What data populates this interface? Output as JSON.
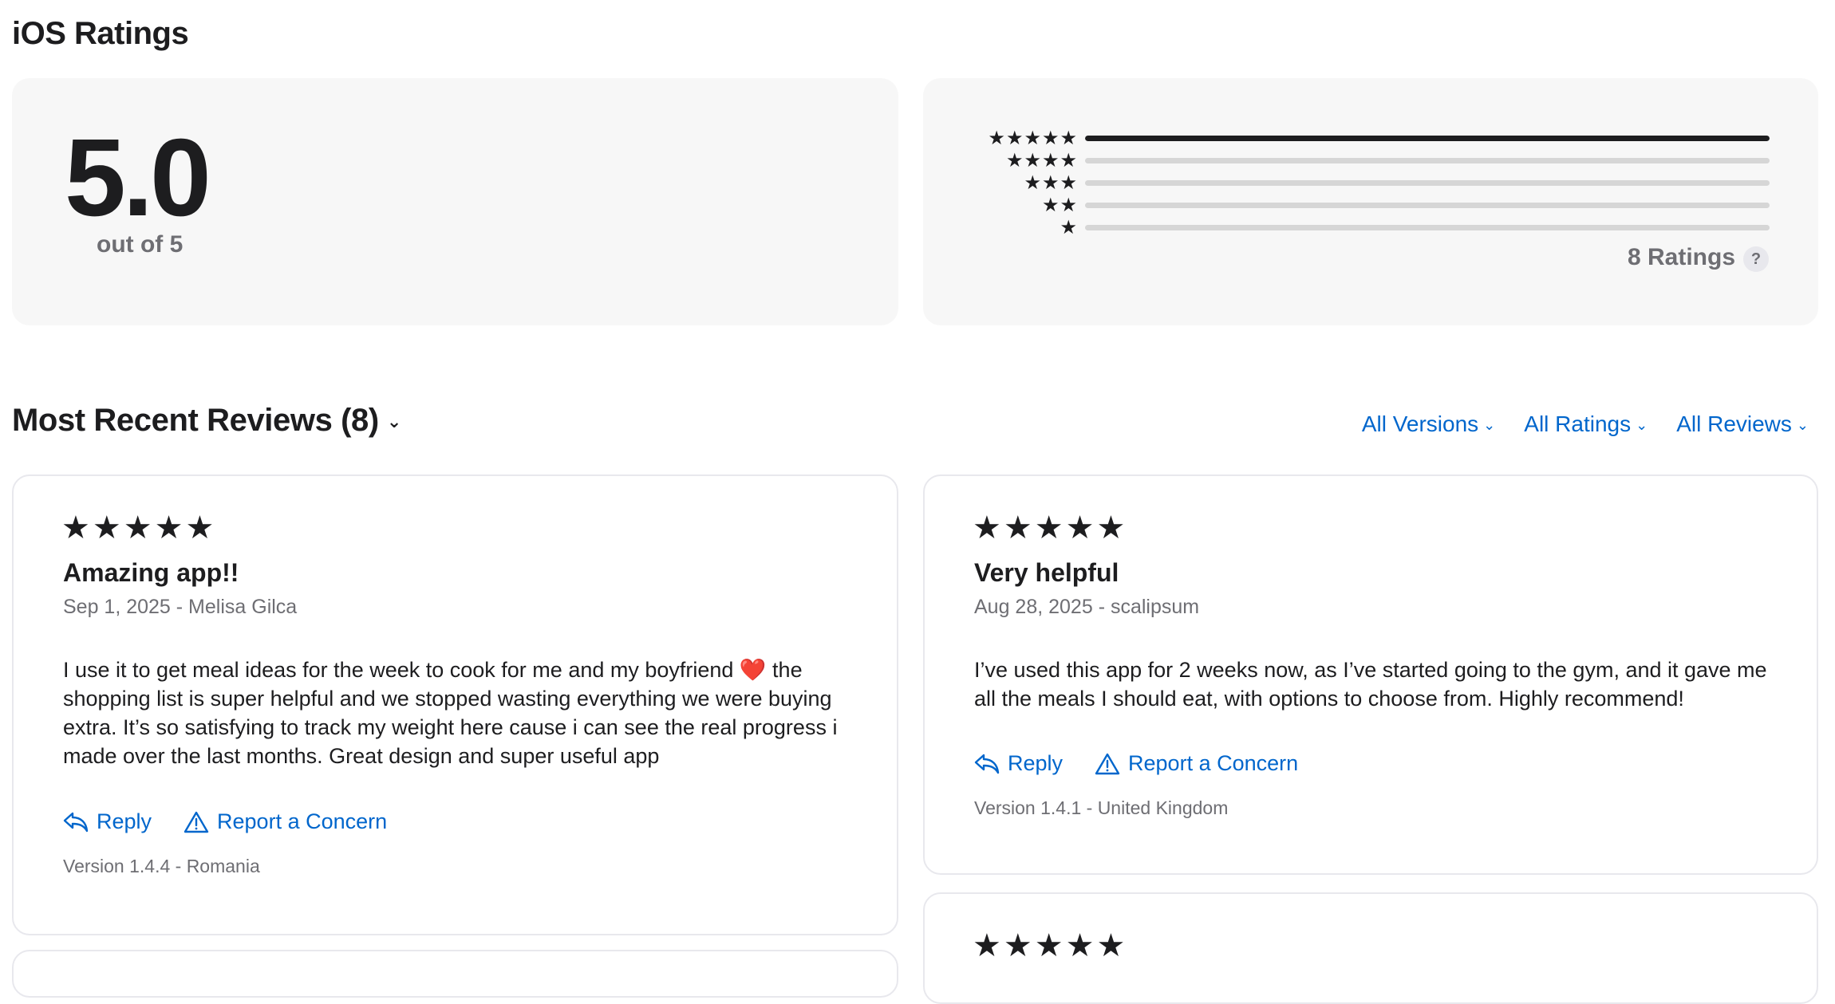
{
  "ratings": {
    "title": "iOS Ratings",
    "average": "5.0",
    "out_of": "out of 5",
    "histogram": [
      {
        "stars": "★★★★★",
        "fraction": 1.0
      },
      {
        "stars": "★★★★",
        "fraction": 0.0
      },
      {
        "stars": "★★★",
        "fraction": 0.0
      },
      {
        "stars": "★★",
        "fraction": 0.0
      },
      {
        "stars": "★",
        "fraction": 0.0
      }
    ],
    "count_label": "8 Ratings",
    "help_glyph": "?"
  },
  "reviews": {
    "title": "Most Recent Reviews (8)",
    "title_chevron": "⌄",
    "filters": [
      {
        "label": "All Versions",
        "chevron": "⌄"
      },
      {
        "label": "All Ratings",
        "chevron": "⌄"
      },
      {
        "label": "All Reviews",
        "chevron": "⌄"
      }
    ],
    "items": [
      {
        "stars": "★★★★★",
        "title": "Amazing app!!",
        "meta": "Sep 1, 2025 - Melisa Gilca",
        "body": "I use it to get meal ideas for the week to cook for me and my boyfriend ❤️ the shopping list is super helpful and we stopped wasting everything we were buying extra. It’s so satisfying to track my weight here cause i can see the real progress i made over the last months. Great design and super useful app",
        "reply": "Reply",
        "report": "Report a Concern",
        "footer": "Version 1.4.4 - Romania"
      },
      {
        "stars": "★★★★★",
        "title": "Very helpful",
        "meta": "Aug 28, 2025 - scalipsum",
        "body": "I’ve used this app for 2 weeks now, as I’ve started going to the gym, and it gave me all the meals I should eat, with options to choose from. Highly recommend!",
        "reply": "Reply",
        "report": "Report a Concern",
        "footer": "Version 1.4.1 - United Kingdom"
      },
      {
        "stars": "★★★★★"
      }
    ]
  },
  "icons": {
    "reply": "reply-arrow-icon",
    "report": "warning-triangle-icon",
    "chevron": "chevron-down-icon"
  },
  "colors": {
    "link": "#0066cc",
    "text": "#1d1d1f",
    "secondary": "#6e6e73",
    "card_bg": "#f7f7f7",
    "bar_bg": "#d6d6d6"
  }
}
